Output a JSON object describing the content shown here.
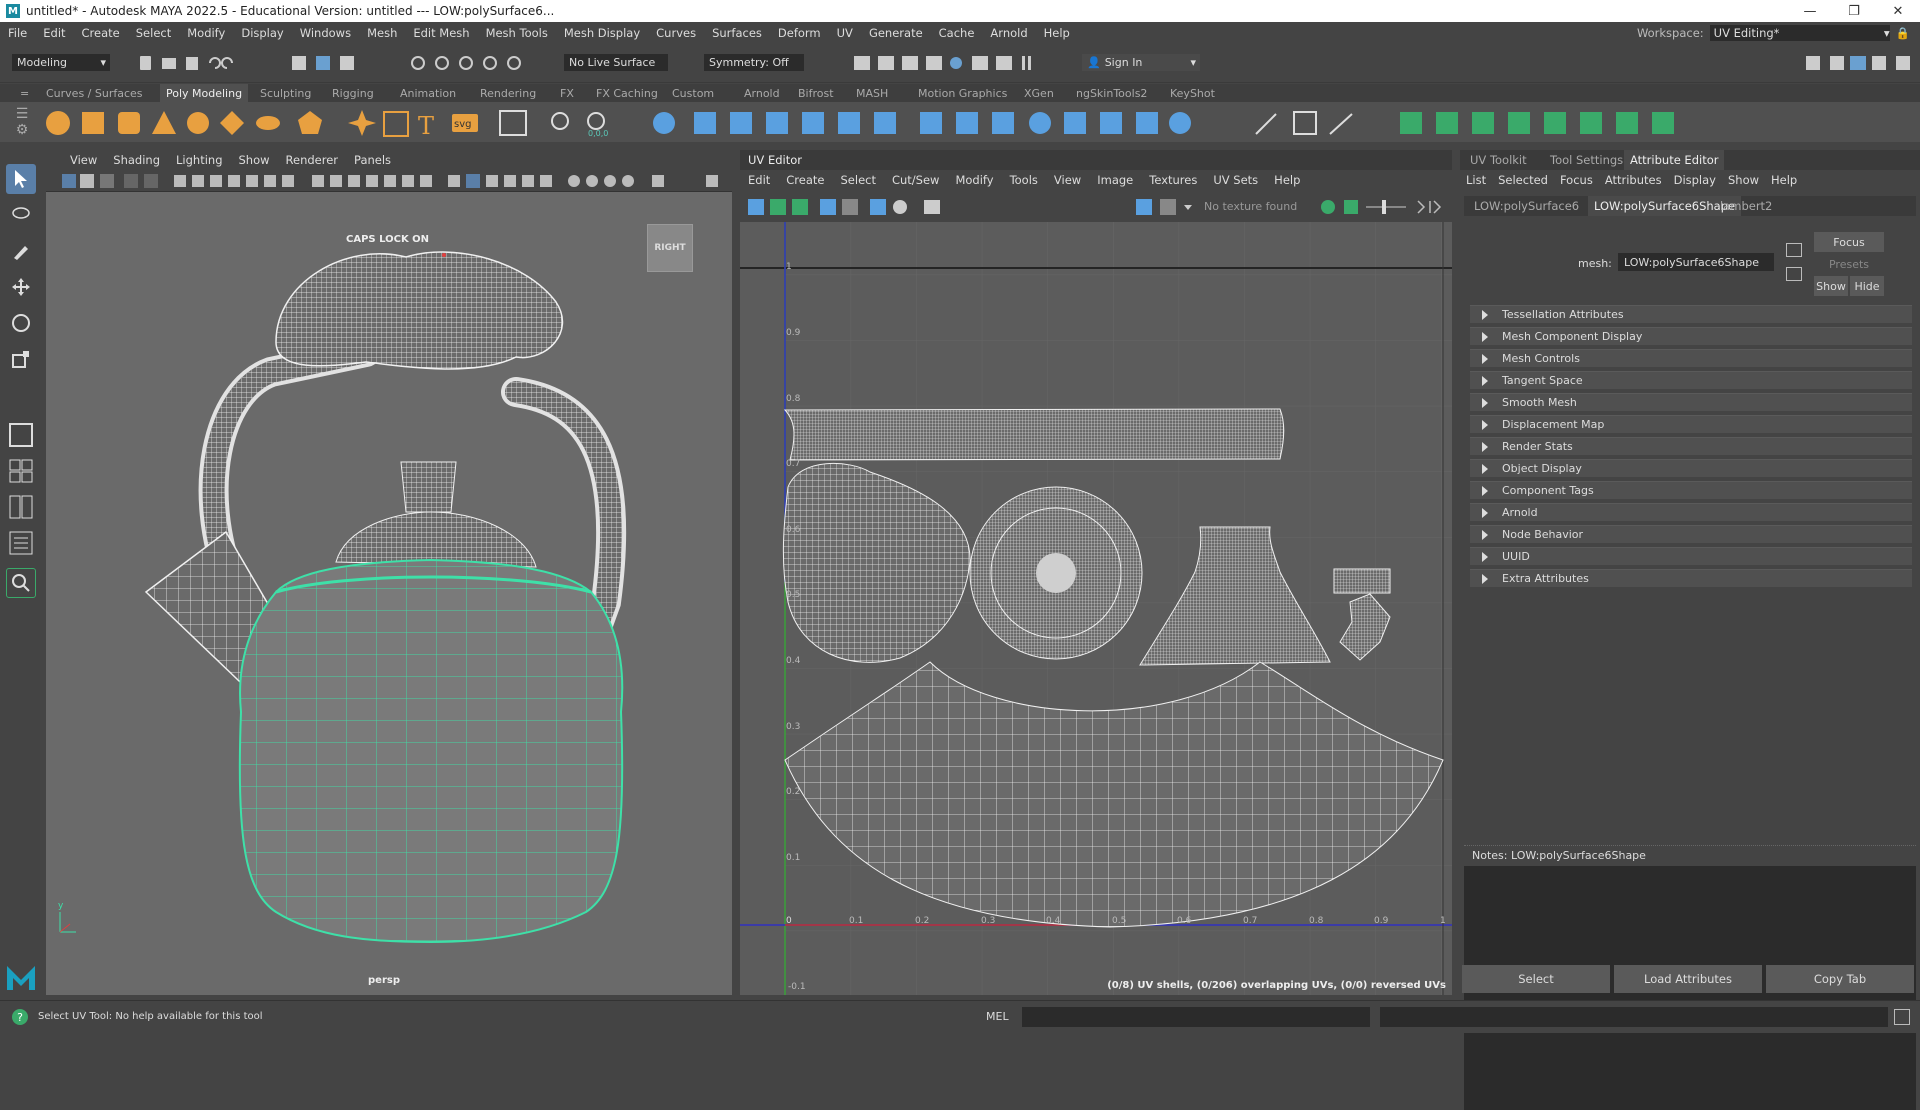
{
  "titlebar": {
    "text": "untitled* - Autodesk MAYA 2022.5 - Educational Version: untitled  ---  LOW:polySurface6...",
    "logo": "M"
  },
  "menubar": {
    "items": [
      "File",
      "Edit",
      "Create",
      "Select",
      "Modify",
      "Display",
      "Windows",
      "Mesh",
      "Edit Mesh",
      "Mesh Tools",
      "Mesh Display",
      "Curves",
      "Surfaces",
      "Deform",
      "UV",
      "Generate",
      "Cache",
      "Arnold",
      "Help"
    ]
  },
  "workspace": {
    "label": "Workspace:",
    "value": "UV Editing*"
  },
  "statusline": {
    "mode": "Modeling",
    "live_surface": "No Live Surface",
    "symmetry": "Symmetry: Off",
    "sign_in": "Sign In"
  },
  "shelf": {
    "tabs": [
      "Curves / Surfaces",
      "Poly Modeling",
      "Sculpting",
      "Rigging",
      "Animation",
      "Rendering",
      "FX",
      "FX Caching",
      "Custom",
      "Arnold",
      "Bifrost",
      "MASH",
      "Motion Graphics",
      "XGen",
      "ngSkinTools2",
      "KeyShot"
    ],
    "active": "Poly Modeling",
    "coord_label": "0,0,0"
  },
  "viewport": {
    "menu": [
      "View",
      "Shading",
      "Lighting",
      "Show",
      "Renderer",
      "Panels"
    ],
    "caps_lock": "CAPS LOCK ON",
    "cube_label": "RIGHT",
    "camera": "persp"
  },
  "uv_editor": {
    "title": "UV Editor",
    "menu": [
      "Edit",
      "Create",
      "Select",
      "Cut/Sew",
      "Modify",
      "Tools",
      "View",
      "Image",
      "Textures",
      "UV Sets",
      "Help"
    ],
    "texture_status": "No texture found",
    "status": "(0/8) UV shells, (0/206) overlapping UVs, (0/0) reversed UVs",
    "x_ticks": [
      "0",
      "0.1",
      "0.2",
      "0.3",
      "0.4",
      "0.5",
      "0.6",
      "0.7",
      "0.8",
      "0.9",
      "1"
    ],
    "y_ticks": [
      "1",
      "0.9",
      "0.8",
      "0.7",
      "0.6",
      "0.5",
      "0.4",
      "0.3",
      "0.2",
      "0.1",
      "-0.1"
    ]
  },
  "attribute_editor": {
    "top_tabs": [
      "UV Toolkit",
      "Tool Settings",
      "Attribute Editor"
    ],
    "active_tab": "Attribute Editor",
    "menu": [
      "List",
      "Selected",
      "Focus",
      "Attributes",
      "Display",
      "Show",
      "Help"
    ],
    "node_tabs": [
      "LOW:polySurface6",
      "LOW:polySurface6Shape",
      "lambert2"
    ],
    "active_node": "LOW:polySurface6Shape",
    "mesh_label": "mesh:",
    "mesh_value": "LOW:polySurface6Shape",
    "focus": "Focus",
    "presets": "Presets",
    "show": "Show",
    "hide": "Hide",
    "sections": [
      "Tessellation Attributes",
      "Mesh Component Display",
      "Mesh Controls",
      "Tangent Space",
      "Smooth Mesh",
      "Displacement Map",
      "Render Stats",
      "Object Display",
      "Component Tags",
      "Arnold",
      "Node Behavior",
      "UUID",
      "Extra Attributes"
    ],
    "notes_label": "Notes:  LOW:polySurface6Shape",
    "buttons": [
      "Select",
      "Load Attributes",
      "Copy Tab"
    ]
  },
  "helpline": {
    "text": "Select UV Tool: No help available for this tool",
    "mel": "MEL"
  },
  "colors": {
    "accent": "#5ac8b8",
    "wire": "#e8e8e8",
    "green_sel": "#40e0a0",
    "orange_icon": "#e8a040",
    "green_icon": "#3aaa6a"
  }
}
